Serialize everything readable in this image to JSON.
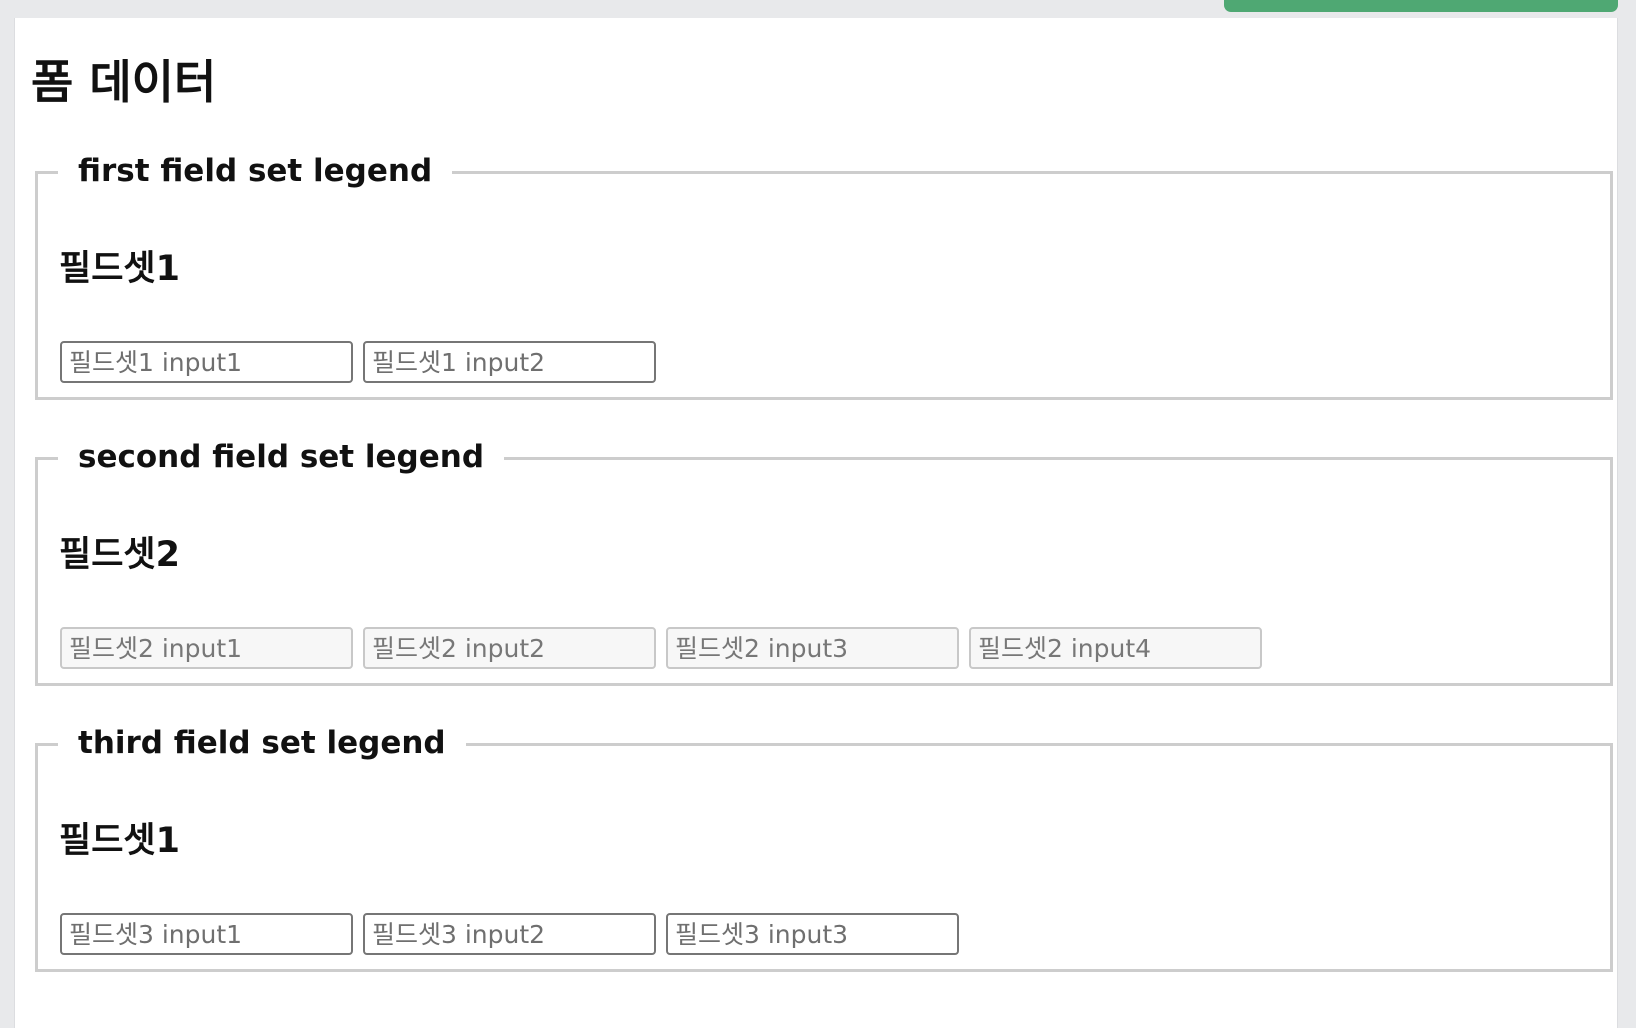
{
  "page": {
    "title": "폼 데이터"
  },
  "fieldsets": [
    {
      "legend": "first field set legend",
      "heading": "필드셋1",
      "disabled": false,
      "inputs": [
        {
          "value": "",
          "placeholder": "필드셋1 input1"
        },
        {
          "value": "",
          "placeholder": "필드셋1 input2"
        }
      ]
    },
    {
      "legend": "second field set legend",
      "heading": "필드셋2",
      "disabled": true,
      "inputs": [
        {
          "value": "",
          "placeholder": "필드셋2 input1"
        },
        {
          "value": "",
          "placeholder": "필드셋2 input2"
        },
        {
          "value": "",
          "placeholder": "필드셋2 input3"
        },
        {
          "value": "",
          "placeholder": "필드셋2 input4"
        }
      ]
    },
    {
      "legend": "third field set legend",
      "heading": "필드셋1",
      "disabled": false,
      "inputs": [
        {
          "value": "",
          "placeholder": "필드셋3 input1"
        },
        {
          "value": "",
          "placeholder": "필드셋3 input2"
        },
        {
          "value": "",
          "placeholder": "필드셋3 input3"
        }
      ]
    }
  ],
  "colors": {
    "accent": "#4fa873",
    "fieldset_border": "#cdcdcd",
    "input_border": "#767676",
    "disabled_background": "#f7f7f7"
  }
}
